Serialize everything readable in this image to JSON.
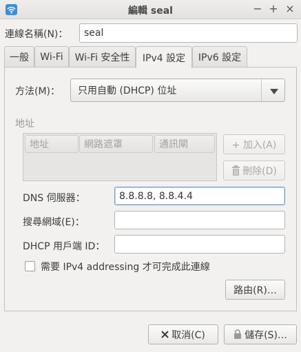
{
  "window": {
    "title": "編輯 seal",
    "minimize": "−",
    "maximize": "+",
    "close": "×"
  },
  "connection": {
    "name_label": "連線名稱(N)：",
    "name_value": "seal"
  },
  "tabs": [
    {
      "label": "一般"
    },
    {
      "label": "Wi-Fi"
    },
    {
      "label": "Wi-Fi 安全性"
    },
    {
      "label": "IPv4 設定",
      "active": true
    },
    {
      "label": "IPv6 設定"
    }
  ],
  "ipv4": {
    "method_label": "方法(M)：",
    "method_value": "只用自動 (DHCP) 位址",
    "address_section": "地址",
    "columns": [
      "地址",
      "網路遮罩",
      "通訊閘"
    ],
    "add_button": "+ 加入(A)",
    "delete_button": "刪除(D)",
    "dns_label": "DNS 伺服器：",
    "dns_value": "8.8.8.8, 8.8.4.4",
    "search_label": "搜尋網域(E)：",
    "search_value": "",
    "dhcp_label": "DHCP 用戶端 ID：",
    "dhcp_value": "",
    "require_checkbox_label": "需要 IPv4 addressing 才可完成此連線",
    "require_checked": false,
    "routes_button": "路由(R)…"
  },
  "footer": {
    "cancel_button": "取消(C)",
    "save_button": "儲存(S)…"
  },
  "colors": {
    "background": "#f2f1f0",
    "accent": "#3a8edb",
    "focus_border": "#6c9bd2"
  }
}
